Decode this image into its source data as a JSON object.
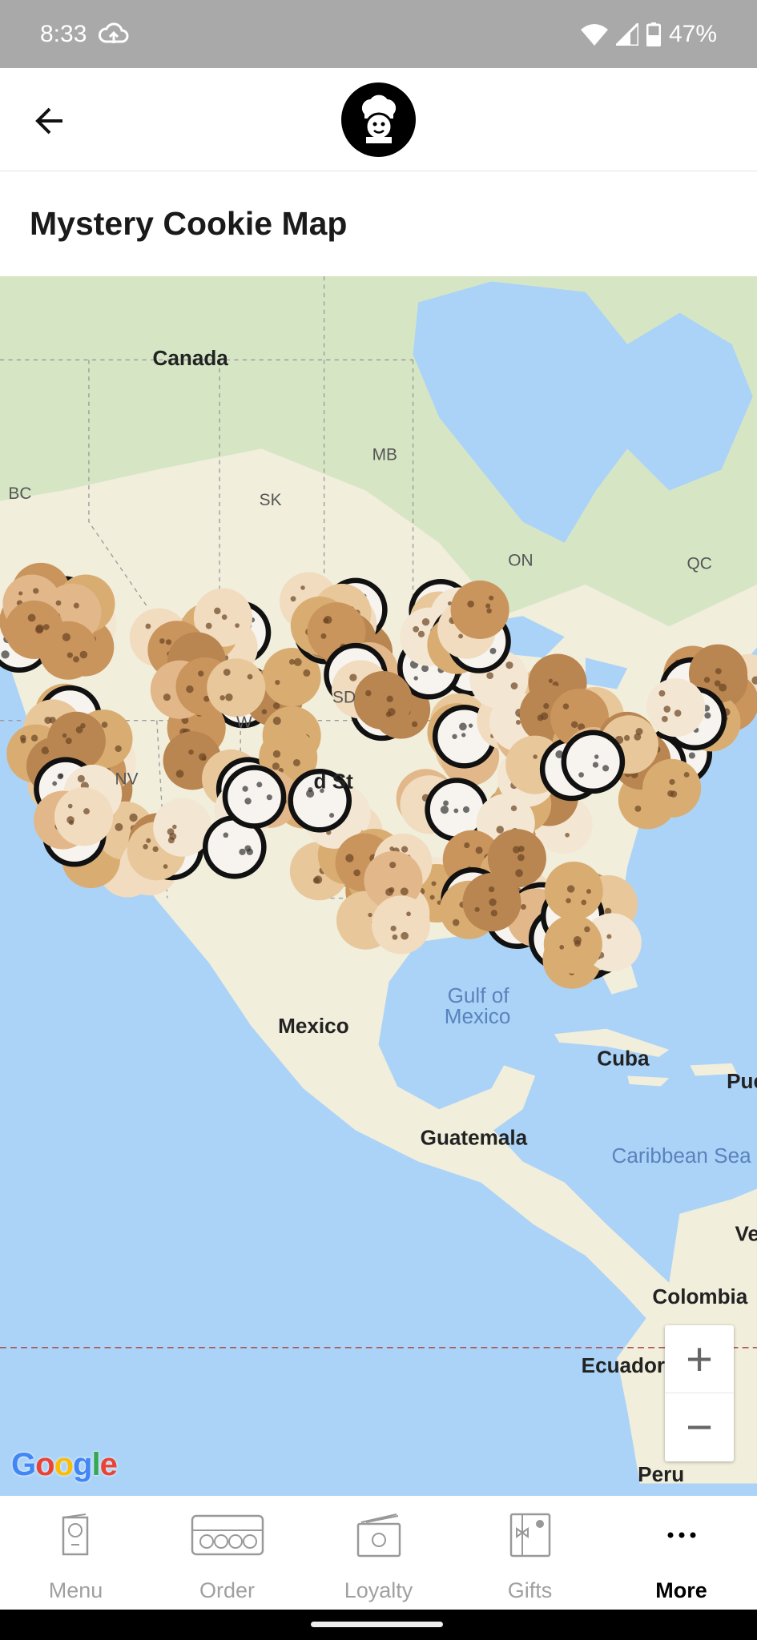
{
  "status_bar": {
    "time": "8:33",
    "battery": "47%",
    "icons": [
      "cloud-upload-icon",
      "wifi-icon",
      "signal-icon",
      "battery-icon"
    ]
  },
  "header": {
    "back_icon": "arrow-left-icon",
    "logo": "chef-cookie-logo"
  },
  "page": {
    "title": "Mystery Cookie Map"
  },
  "map": {
    "labels": {
      "canada": "Canada",
      "mb": "MB",
      "sk": "SK",
      "bc": "BC",
      "on": "ON",
      "qc": "QC",
      "sd": "SD",
      "wy": "W",
      "nv": "NV",
      "us": "d St",
      "gulf": "Gulf of",
      "gulf2": "Mexico",
      "mexico": "Mexico",
      "cuba": "Cuba",
      "pr": "Pue",
      "guatemala": "Guatemala",
      "caribbean": "Caribbean Sea",
      "ve": "Ve",
      "colombia": "Colombia",
      "ecuador": "Ecuador",
      "peru": "Peru"
    },
    "zoom_in": "+",
    "zoom_out": "−",
    "attribution": "Google",
    "colors": {
      "water": "#abd3f7",
      "land": "#f1eedc",
      "forest": "#cfe3bf",
      "google_blue": "#4285f4",
      "google_red": "#ea4335",
      "google_yellow": "#fbbc05",
      "google_green": "#34a853"
    }
  },
  "nav": {
    "items": [
      {
        "label": "Menu",
        "icon": "menu-card-icon"
      },
      {
        "label": "Order",
        "icon": "cookie-box-icon"
      },
      {
        "label": "Loyalty",
        "icon": "loyalty-card-icon"
      },
      {
        "label": "Gifts",
        "icon": "gift-card-icon"
      },
      {
        "label": "More",
        "icon": "more-dots-icon",
        "active": true
      }
    ]
  }
}
